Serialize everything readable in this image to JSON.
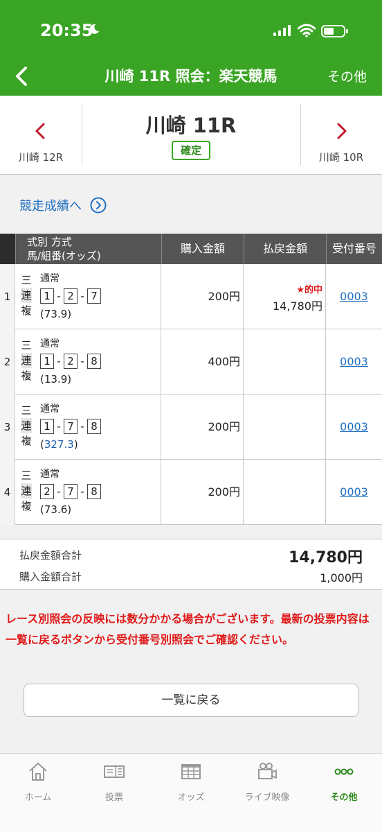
{
  "status_bar": {
    "time": "20:35"
  },
  "header": {
    "title": "川崎 11R 照会：楽天競馬",
    "right_label": "その他"
  },
  "race_nav": {
    "prev_label": "川崎 12R",
    "current_title": "川崎 11R",
    "status_badge": "確定",
    "next_label": "川崎 10R"
  },
  "results_link": "競走成績へ",
  "table": {
    "headers": {
      "kind_line1": "式別 方式",
      "kind_line2": "馬/組番(オッズ)",
      "amount": "購入金額",
      "payout": "払戻金額",
      "receipt": "受付番号"
    },
    "rows": [
      {
        "no": "1",
        "bet_type": [
          "三",
          "連",
          "複"
        ],
        "method": "通常",
        "combo": [
          "1",
          "2",
          "7"
        ],
        "odds": "(73.9)",
        "amount": "200円",
        "hit": "★的中",
        "payout": "14,780円",
        "receipt": "0003"
      },
      {
        "no": "2",
        "bet_type": [
          "三",
          "連",
          "複"
        ],
        "method": "通常",
        "combo": [
          "1",
          "2",
          "8"
        ],
        "odds": "(13.9)",
        "amount": "400円",
        "hit": "",
        "payout": "",
        "receipt": "0003"
      },
      {
        "no": "3",
        "bet_type": [
          "三",
          "連",
          "複"
        ],
        "method": "通常",
        "combo": [
          "1",
          "7",
          "8"
        ],
        "odds": "327.3",
        "amount": "200円",
        "hit": "",
        "payout": "",
        "receipt": "0003"
      },
      {
        "no": "4",
        "bet_type": [
          "三",
          "連",
          "複"
        ],
        "method": "通常",
        "combo": [
          "2",
          "7",
          "8"
        ],
        "odds": "(73.6)",
        "amount": "200円",
        "hit": "",
        "payout": "",
        "receipt": "0003"
      }
    ]
  },
  "totals": {
    "payout_label": "払戻金額合計",
    "payout_value": "14,780円",
    "purchase_label": "購入金額合計",
    "purchase_value": "1,000円"
  },
  "notice": "レース別照会の反映には数分かかる場合がございます。最新の投票内容は一覧に戻るボタンから受付番号別照会でご確認ください。",
  "back_to_list": "一覧に戻る",
  "tabbar": {
    "tabs": [
      {
        "label": "ホーム",
        "icon": "home-icon"
      },
      {
        "label": "投票",
        "icon": "ticket-icon"
      },
      {
        "label": "オッズ",
        "icon": "odds-icon"
      },
      {
        "label": "ライブ映像",
        "icon": "video-camera-icon"
      },
      {
        "label": "その他",
        "icon": "more-icon",
        "active": true
      }
    ]
  },
  "colors": {
    "brand_green": "#3aa524",
    "link_blue": "#1f6fc2",
    "alert_red": "#e01818"
  }
}
